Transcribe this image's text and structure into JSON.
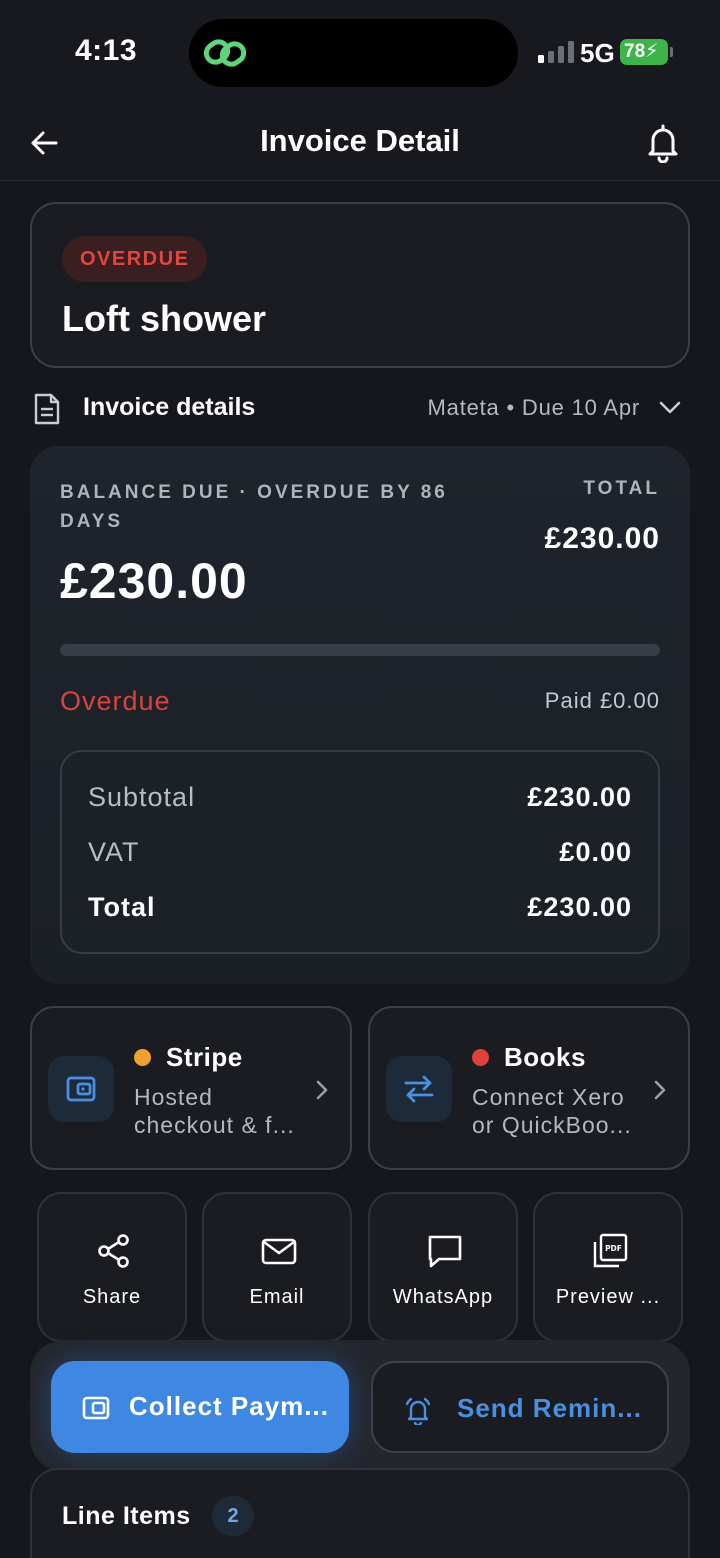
{
  "status_bar": {
    "time": "4:13",
    "network": "5G",
    "battery": "78"
  },
  "header": {
    "title": "Invoice Detail",
    "back_icon": "arrow-left-icon",
    "bell_icon": "bell-icon"
  },
  "invoice": {
    "status_badge": "OVERDUE",
    "job_name": "Loft shower"
  },
  "details_row": {
    "label": "Invoice details",
    "meta": "Mateta • Due 10 Apr"
  },
  "balance": {
    "label": "BALANCE DUE · OVERDUE BY 86 DAYS",
    "amount": "£230.00",
    "total_label": "TOTAL",
    "total_value": "£230.00",
    "paid_fraction": 0,
    "status": "Overdue",
    "paid": "Paid £0.00",
    "summary": [
      {
        "label": "Subtotal",
        "value": "£230.00"
      },
      {
        "label": "VAT",
        "value": "£0.00"
      },
      {
        "label": "Total",
        "value": "£230.00"
      }
    ]
  },
  "integrations": [
    {
      "name": "Stripe",
      "description": "Hosted checkout & f...",
      "status_color": "#f0a030",
      "icon": "wallet-icon"
    },
    {
      "name": "Books",
      "description": "Connect Xero or QuickBoo...",
      "status_color": "#e0413a",
      "icon": "sync-arrows-icon"
    }
  ],
  "actions": [
    {
      "label": "Share",
      "icon": "share-icon"
    },
    {
      "label": "Email",
      "icon": "mail-icon"
    },
    {
      "label": "WhatsApp",
      "icon": "message-icon"
    },
    {
      "label": "Preview ...",
      "icon": "pdf-icon"
    }
  ],
  "buttons": {
    "primary": "Collect Paym...",
    "secondary": "Send Remin..."
  },
  "line_items": {
    "title": "Line Items",
    "count": "2"
  },
  "colors": {
    "accent": "#3e88e4",
    "overdue": "#d8443d",
    "background": "#15171c"
  }
}
